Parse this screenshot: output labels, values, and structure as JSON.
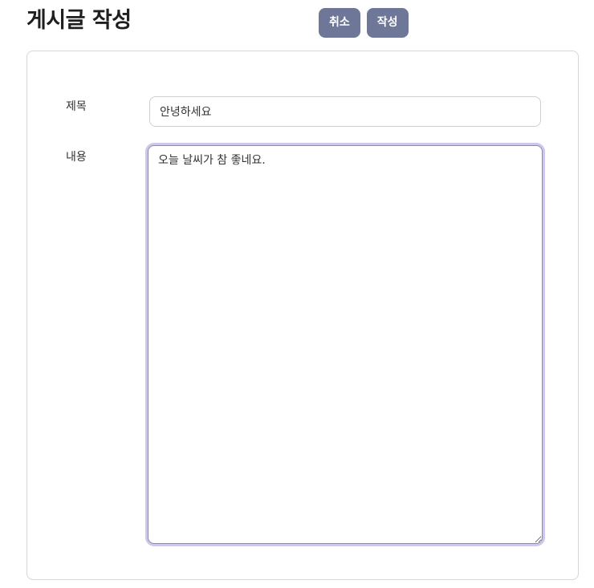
{
  "header": {
    "title": "게시글 작성",
    "cancel_label": "취소",
    "submit_label": "작성"
  },
  "form": {
    "title_label": "제목",
    "title_value": "안녕하세요",
    "content_label": "내용",
    "content_value": "오늘 날씨가 참 좋네요."
  },
  "colors": {
    "button_bg": "#6f7798",
    "focus_ring": "#cdc7ee",
    "card_border": "#d6d6d6"
  }
}
